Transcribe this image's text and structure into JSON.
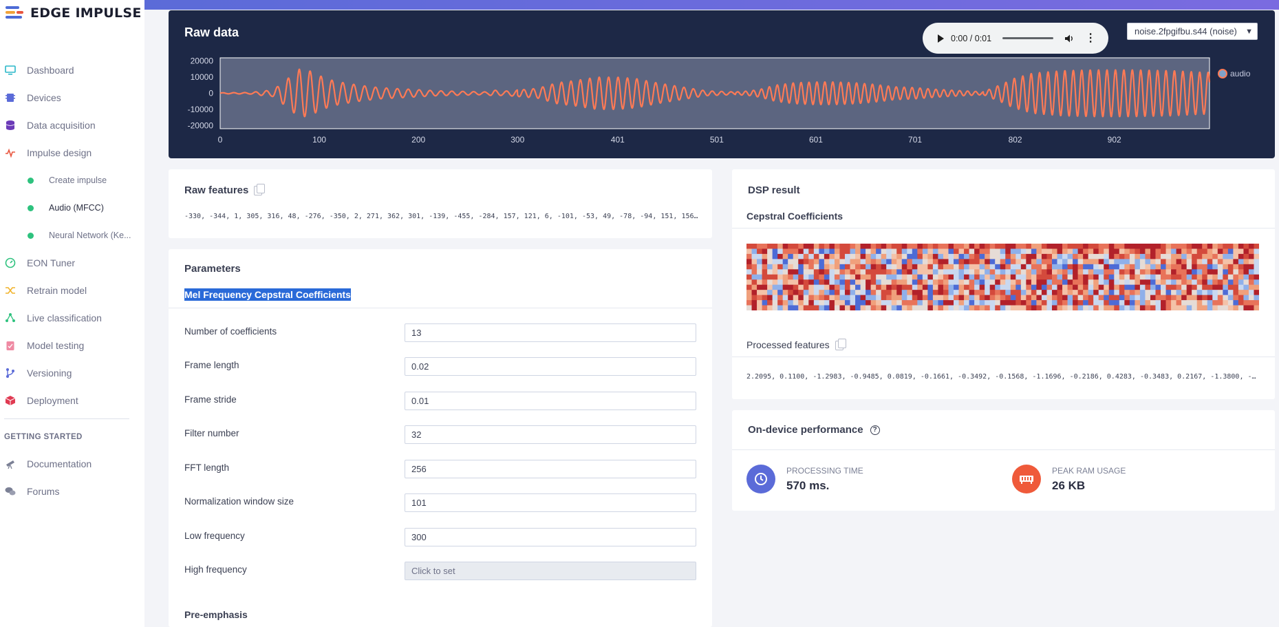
{
  "app": {
    "logo_text": "EDGE IMPULSE"
  },
  "colors": {
    "accent": "#5b6bd8",
    "signal": "#ff7a55",
    "panel": "#1d2846",
    "success": "#2ec27e"
  },
  "sidebar": {
    "items": [
      {
        "label": "Dashboard",
        "icon": "monitor-icon"
      },
      {
        "label": "Devices",
        "icon": "chip-icon"
      },
      {
        "label": "Data acquisition",
        "icon": "database-icon"
      },
      {
        "label": "Impulse design",
        "icon": "pulse-icon"
      }
    ],
    "sub_items": [
      {
        "label": "Create impulse"
      },
      {
        "label": "Audio (MFCC)"
      },
      {
        "label": "Neural Network (Ke..."
      }
    ],
    "items2": [
      {
        "label": "EON Tuner",
        "icon": "gauge-icon"
      },
      {
        "label": "Retrain model",
        "icon": "shuffle-icon"
      },
      {
        "label": "Live classification",
        "icon": "network-icon"
      },
      {
        "label": "Model testing",
        "icon": "clipboard-icon"
      },
      {
        "label": "Versioning",
        "icon": "branch-icon"
      },
      {
        "label": "Deployment",
        "icon": "box-icon"
      }
    ],
    "section_title": "GETTING STARTED",
    "getting_started": [
      {
        "label": "Documentation",
        "icon": "telescope-icon"
      },
      {
        "label": "Forums",
        "icon": "chat-icon"
      }
    ]
  },
  "raw_data": {
    "title": "Raw data",
    "audio": {
      "time": "0:00 / 0:01"
    },
    "sample_select": "noise.2fpgifbu.s44 (noise)",
    "legend": "audio"
  },
  "chart_data": {
    "type": "line",
    "series": [
      {
        "name": "audio",
        "envelope": [
          [
            0,
            300
          ],
          [
            30,
            450
          ],
          [
            44,
            1500
          ],
          [
            52,
            1800
          ],
          [
            60,
            5000
          ],
          [
            70,
            10000
          ],
          [
            80,
            15000
          ],
          [
            90,
            14000
          ],
          [
            100,
            11000
          ],
          [
            110,
            8500
          ],
          [
            120,
            7000
          ],
          [
            140,
            5000
          ],
          [
            160,
            3500
          ],
          [
            190,
            2500
          ],
          [
            220,
            1500
          ],
          [
            270,
            800
          ],
          [
            276,
            2000
          ],
          [
            285,
            1200
          ],
          [
            300,
            2000
          ],
          [
            320,
            3000
          ],
          [
            340,
            6500
          ],
          [
            360,
            8000
          ],
          [
            380,
            10000
          ],
          [
            400,
            10000
          ],
          [
            420,
            9000
          ],
          [
            440,
            6500
          ],
          [
            460,
            4500
          ],
          [
            490,
            1500
          ],
          [
            520,
            800
          ],
          [
            535,
            1500
          ],
          [
            545,
            2500
          ],
          [
            560,
            5000
          ],
          [
            580,
            6500
          ],
          [
            600,
            7000
          ],
          [
            620,
            7000
          ],
          [
            640,
            6500
          ],
          [
            660,
            5500
          ],
          [
            680,
            4000
          ],
          [
            700,
            3500
          ],
          [
            720,
            2500
          ],
          [
            750,
            1500
          ],
          [
            770,
            900
          ],
          [
            780,
            3500
          ],
          [
            790,
            6000
          ],
          [
            800,
            9000
          ],
          [
            820,
            12500
          ],
          [
            850,
            14000
          ],
          [
            880,
            14500
          ],
          [
            920,
            14500
          ],
          [
            960,
            14000
          ],
          [
            990,
            13000
          ]
        ]
      }
    ],
    "xticks": [
      0,
      100,
      200,
      300,
      401,
      501,
      601,
      701,
      802,
      902
    ],
    "yticks": [
      20000,
      10000,
      0,
      -10000,
      -20000
    ],
    "xlim": [
      0,
      998
    ],
    "ylim": [
      -22000,
      22000
    ],
    "grid": false
  },
  "raw_features": {
    "title": "Raw features",
    "values": "-330, -344, 1, 305, 316, 48, -276, -350, 2, 271, 362, 301, -139, -455, -284, 157, 121, 6, -101, -53, 49, -78, -94, 151, 156,..."
  },
  "parameters": {
    "title": "Parameters",
    "section": "Mel Frequency Cepstral Coefficients",
    "fields": [
      {
        "label": "Number of coefficients",
        "value": "13"
      },
      {
        "label": "Frame length",
        "value": "0.02"
      },
      {
        "label": "Frame stride",
        "value": "0.01"
      },
      {
        "label": "Filter number",
        "value": "32"
      },
      {
        "label": "FFT length",
        "value": "256"
      },
      {
        "label": "Normalization window size",
        "value": "101"
      },
      {
        "label": "Low frequency",
        "value": "300"
      },
      {
        "label": "High frequency",
        "value": "",
        "placeholder": "Click to set"
      }
    ],
    "pre_emphasis": "Pre-emphasis"
  },
  "dsp": {
    "title": "DSP result",
    "subtitle": "Cepstral Coefficients",
    "heatmap": {
      "rows": 13,
      "cols": 99
    },
    "processed_title": "Processed features",
    "processed_values": "2.2095, 0.1100, -1.2983, -0.9485, 0.0819, -0.1661, -0.3492, -0.1568, -1.1696, -0.2186, 0.4283, -0.3483, 0.2167, -1.3800, -2..."
  },
  "performance": {
    "title": "On-device performance",
    "processing_label": "PROCESSING TIME",
    "processing_value": "570 ms.",
    "ram_label": "PEAK RAM USAGE",
    "ram_value": "26 KB"
  }
}
